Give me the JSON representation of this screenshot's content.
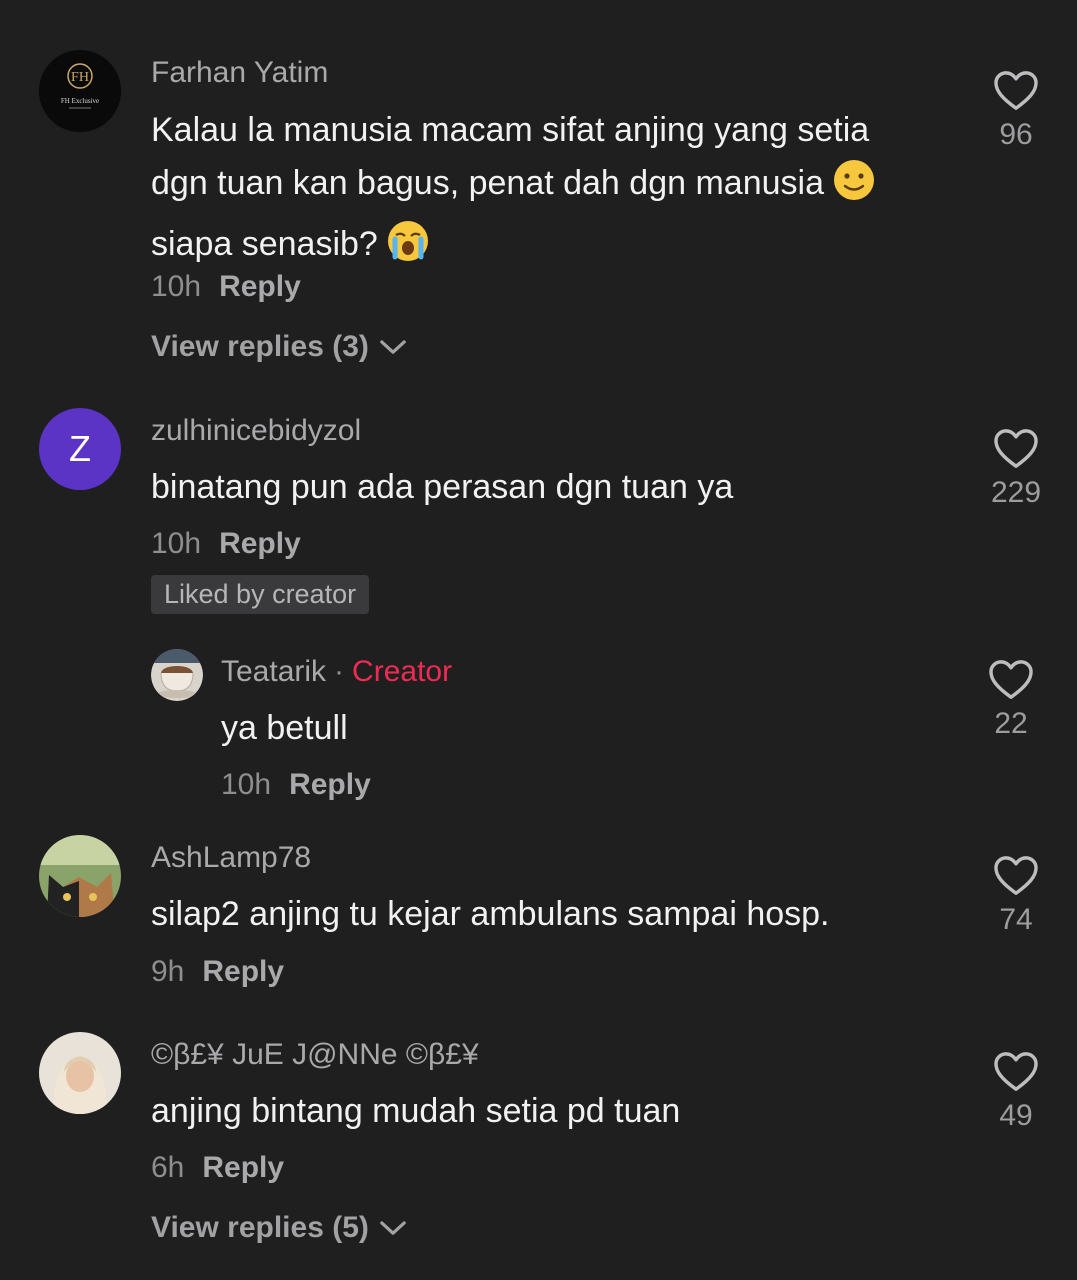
{
  "comments": [
    {
      "username": "Farhan Yatim",
      "lines": [
        "Kalau la manusia macam sifat anjing yang setia",
        "dgn tuan kan bagus, penat dah dgn manusia",
        "siapa senasib?"
      ],
      "time": "10h",
      "reply_label": "Reply",
      "likes": "96",
      "view_replies": "View replies (3)",
      "avatar_text": "FH Exclusive"
    },
    {
      "username": "zulhinicebidyzol",
      "avatar_letter": "Z",
      "text": "binatang pun ada perasan dgn tuan ya",
      "time": "10h",
      "reply_label": "Reply",
      "likes": "229",
      "badge": "Liked by creator",
      "avatar_color": "#5b34c6"
    },
    {
      "username": "Teatarik",
      "creator_label": "Creator",
      "separator": "·",
      "text": "ya betull",
      "time": "10h",
      "reply_label": "Reply",
      "likes": "22"
    },
    {
      "username": "AshLamp78",
      "text": "silap2 anjing tu kejar ambulans sampai hosp.",
      "time": "9h",
      "reply_label": "Reply",
      "likes": "74"
    },
    {
      "username": "©β£¥ JuE J@NNe ©β£¥",
      "text": "anjing bintang mudah setia pd tuan",
      "time": "6h",
      "reply_label": "Reply",
      "likes": "49",
      "view_replies": "View replies (5)"
    }
  ],
  "colors": {
    "background": "#1f1f20",
    "creator": "#ef2b54",
    "avatar_z": "#5b34c6"
  }
}
